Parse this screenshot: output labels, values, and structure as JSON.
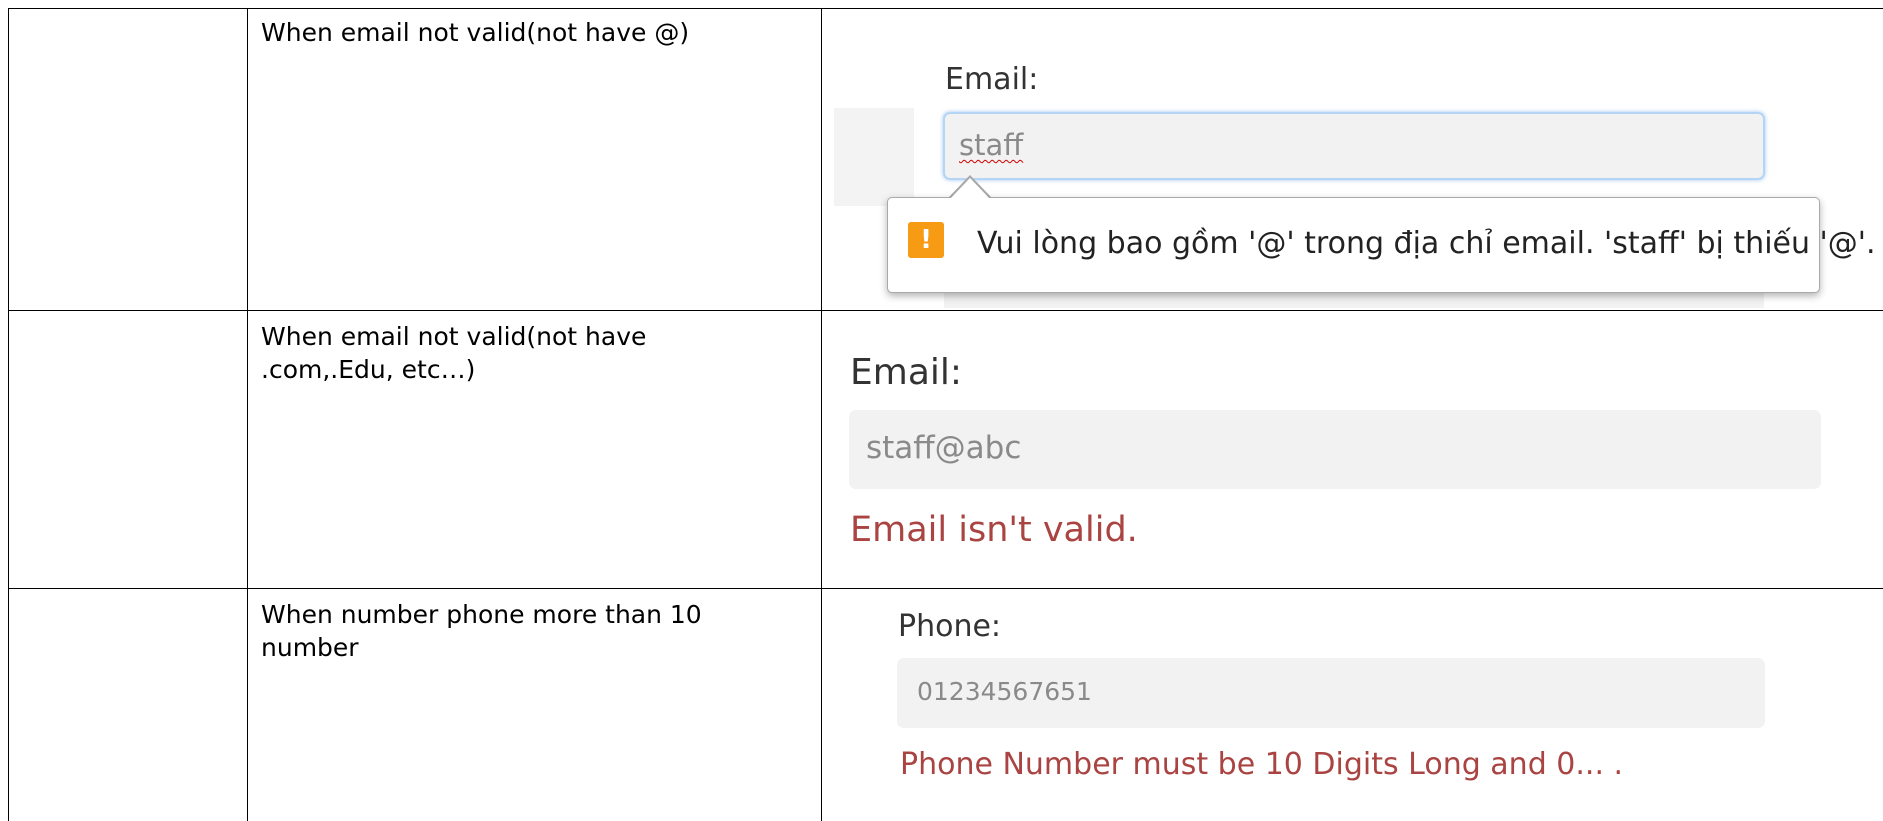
{
  "rows": [
    {
      "description": "When email not valid(not have @)",
      "label": "Email:",
      "value": "staff",
      "tooltip": "Vui lòng bao gồm '@' trong địa chỉ email. 'staff' bị thiếu '@'.",
      "warning_icon": "exclamation-icon",
      "warning_color": "#f79a14"
    },
    {
      "description_line1": "When email not valid(not have",
      "description_line2": ".com,.Edu, etc…)",
      "label": "Email:",
      "value": "staff@abc",
      "error": "Email isn't valid.",
      "error_color": "#a94442"
    },
    {
      "description_line1": "When number phone more than 10",
      "description_line2": "number",
      "label": "Phone:",
      "value": "01234567651",
      "error": "Phone Number must be 10 Digits Long and 0... ."
    }
  ]
}
